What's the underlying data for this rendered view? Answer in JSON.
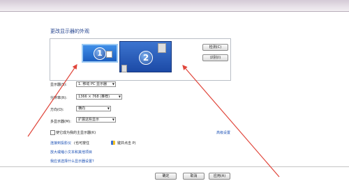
{
  "page": {
    "title": "更改显示器的外观"
  },
  "preview": {
    "monitor1_number": "1",
    "monitor2_number": "2",
    "detect_label": "检测(C)",
    "identify_label": "识别(I)"
  },
  "settings": {
    "display_label": "显示器(S):",
    "display_value": "1. 移动 PC 显示器",
    "resolution_label": "分辨率(R):",
    "resolution_value": "1366 × 768 (推荐)",
    "orientation_label": "方向(O):",
    "orientation_value": "横向",
    "multi_label": "多显示器(M):",
    "multi_value": "扩展这些显示"
  },
  "checkbox": {
    "main_display_label": "使它成为我的主显示器(K)"
  },
  "advanced_label": "高级设置",
  "links": {
    "projector_prefix": "连接到投影仪",
    "projector_suffix": "(也可按住",
    "projector_key": "键并点击 P)",
    "text_size": "放大或缩小文本和其他项目",
    "which_settings": "我应该选择什么显示器设置?"
  },
  "buttons": {
    "ok": "确定",
    "cancel": "取消",
    "apply": "应用(A)"
  },
  "colors": {
    "annotation_arrow": "#e0453a",
    "link": "#1a4fb5",
    "title": "#1f3f8c"
  }
}
